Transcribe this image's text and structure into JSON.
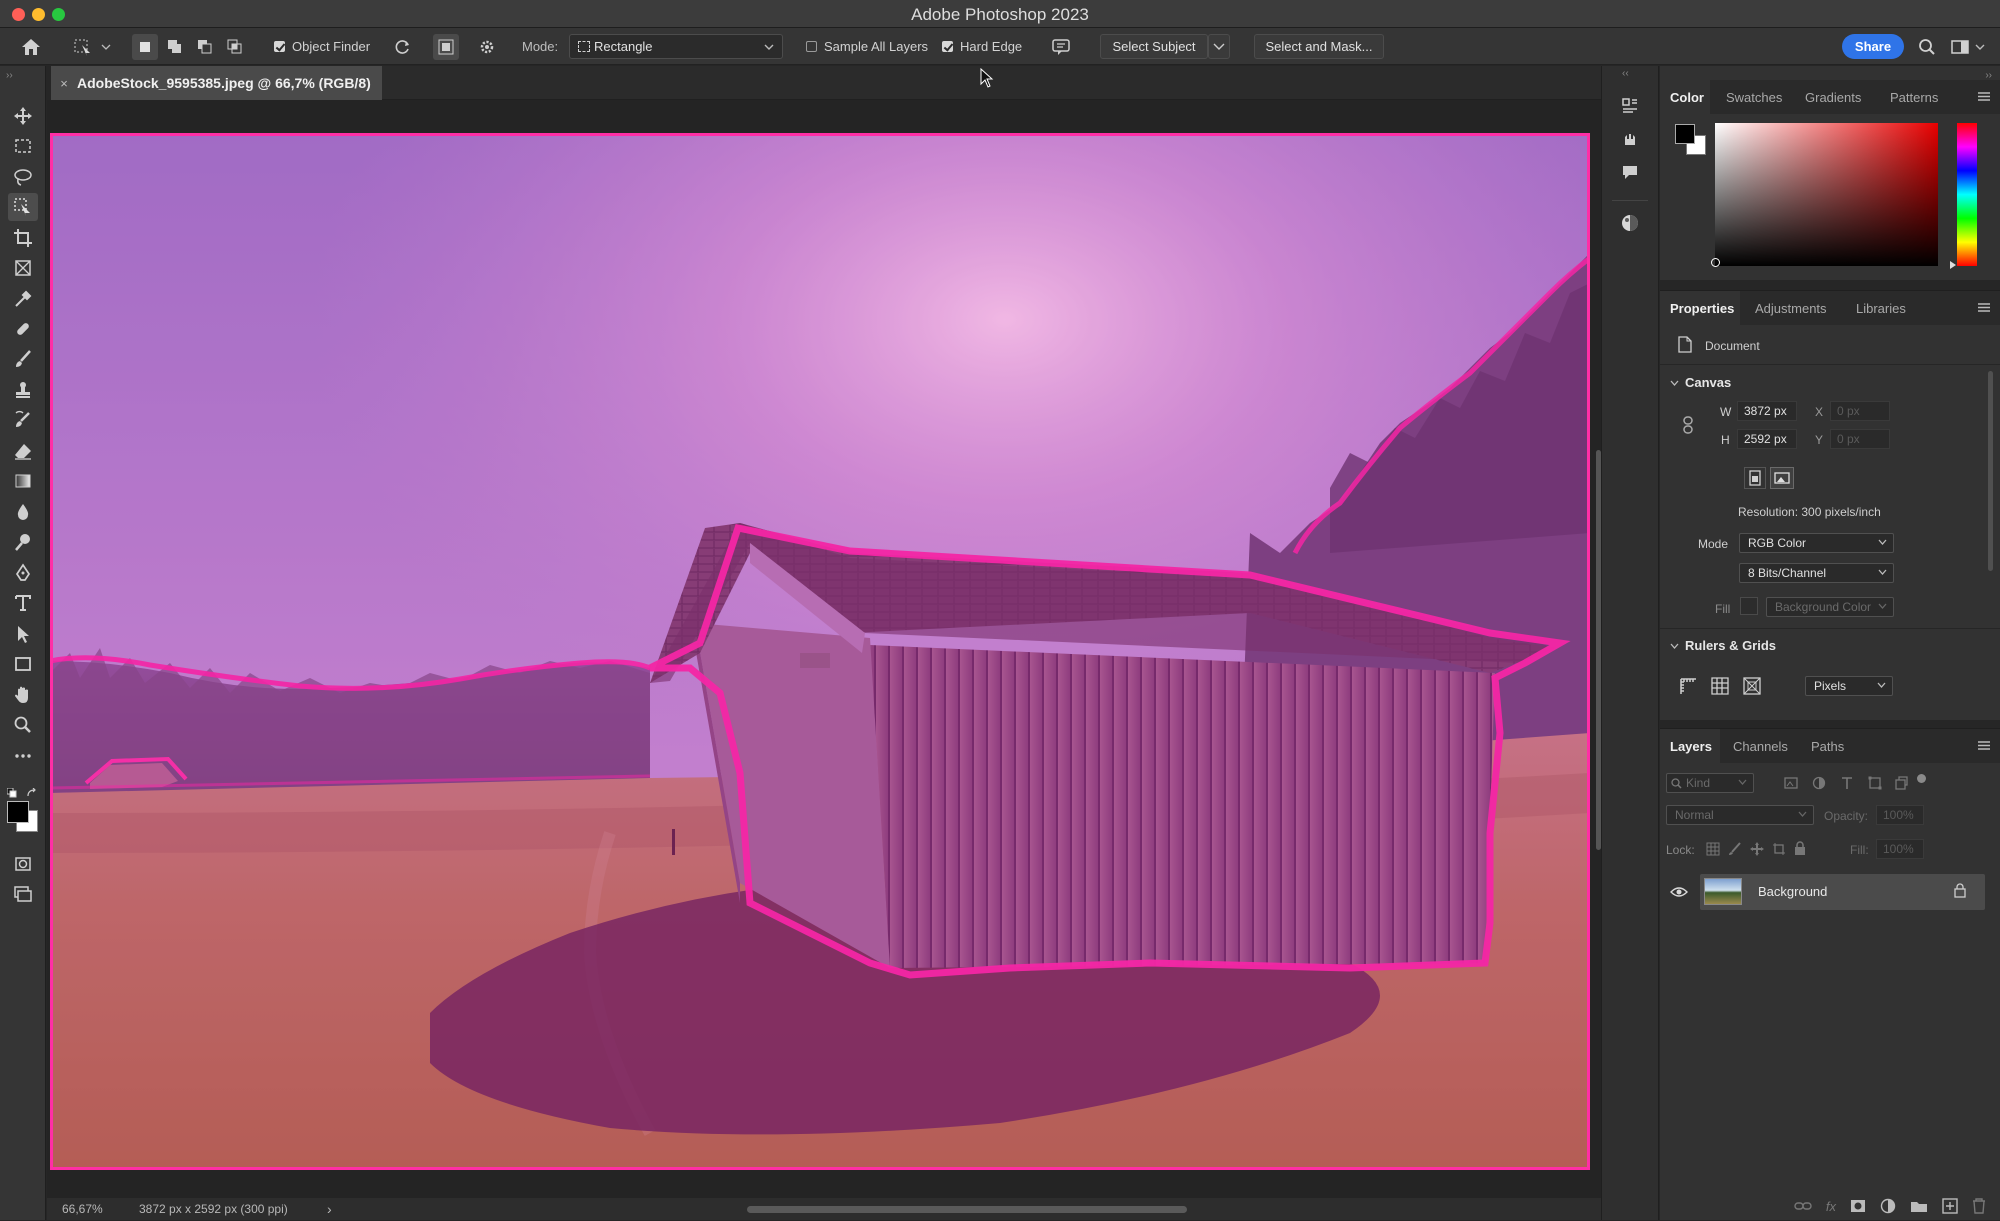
{
  "app": {
    "title": "Adobe Photoshop 2023"
  },
  "options_bar": {
    "object_finder_label": "Object Finder",
    "mode_label": "Mode:",
    "mode_value": "Rectangle",
    "sample_all_layers_label": "Sample All Layers",
    "hard_edge_label": "Hard Edge",
    "select_subject_label": "Select Subject",
    "select_and_mask_label": "Select and Mask...",
    "share_label": "Share",
    "object_finder_checked": true,
    "sample_all_layers_checked": false,
    "hard_edge_checked": true
  },
  "document": {
    "tab_title": "AdobeStock_9595385.jpeg @ 66,7% (RGB/8)",
    "close_glyph": "×"
  },
  "status": {
    "zoom": "66,67%",
    "info": "3872 px x 2592 px (300 ppi)",
    "arrow": "›"
  },
  "color_panel": {
    "tabs": [
      "Color",
      "Swatches",
      "Gradients",
      "Patterns"
    ],
    "active_tab": "Color",
    "foreground": "#000000",
    "background": "#ffffff"
  },
  "properties_panel": {
    "tabs": [
      "Properties",
      "Adjustments",
      "Libraries"
    ],
    "active_tab": "Properties",
    "doc_label": "Document",
    "canvas_header": "Canvas",
    "w_label": "W",
    "w_value": "3872 px",
    "h_label": "H",
    "h_value": "2592 px",
    "x_label": "X",
    "x_value": "0 px",
    "y_label": "Y",
    "y_value": "0 px",
    "resolution": "Resolution: 300 pixels/inch",
    "mode_label": "Mode",
    "mode_value": "RGB Color",
    "bits_value": "8 Bits/Channel",
    "fill_label": "Fill",
    "fill_value": "Background Color",
    "rulers_header": "Rulers & Grids",
    "units_value": "Pixels"
  },
  "layers_panel": {
    "tabs": [
      "Layers",
      "Channels",
      "Paths"
    ],
    "active_tab": "Layers",
    "kind_placeholder": "Kind",
    "blend_mode": "Normal",
    "opacity_label": "Opacity:",
    "opacity_value": "100%",
    "lock_label": "Lock:",
    "fill_label": "Fill:",
    "fill_value": "100%",
    "layers": [
      {
        "name": "Background",
        "visible": true,
        "locked": true
      }
    ]
  },
  "colors": {
    "accent": "#2f74e8",
    "overlay": "#c000a0",
    "selection_edge": "#ff2ea6"
  }
}
